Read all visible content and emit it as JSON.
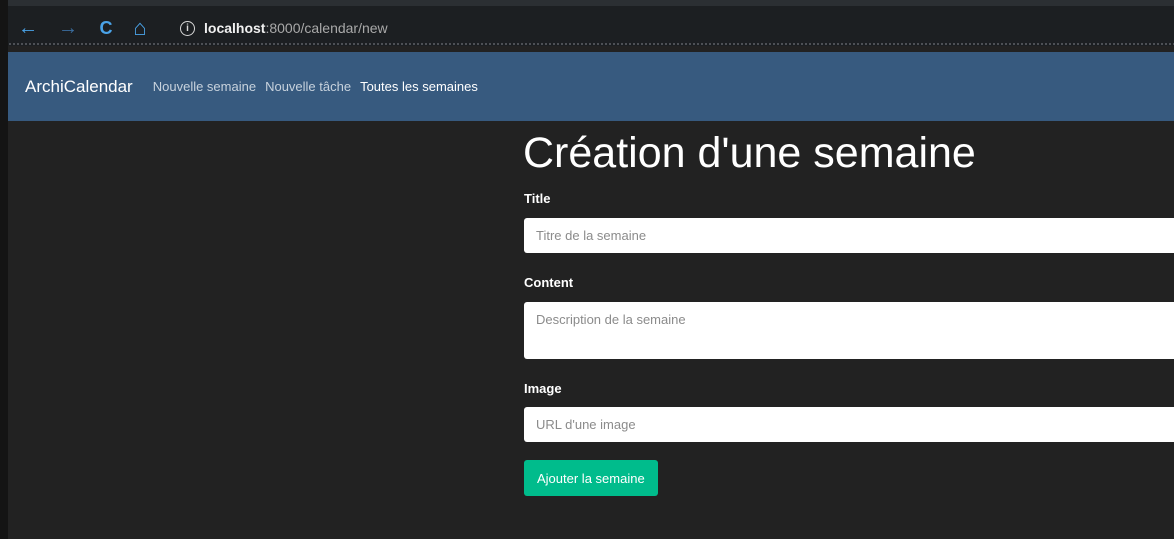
{
  "browser": {
    "back_icon": "←",
    "forward_icon": "→",
    "reload_icon": "C",
    "home_icon": "⌂",
    "info_icon": "i",
    "url_host": "localhost",
    "url_path": ":8000/calendar/new"
  },
  "navbar": {
    "brand": "ArchiCalendar",
    "links": [
      {
        "label": "Nouvelle semaine"
      },
      {
        "label": "Nouvelle tâche"
      },
      {
        "label": "Toutes les semaines"
      }
    ]
  },
  "form": {
    "title": "Création d'une semaine",
    "title_label": "Title",
    "title_placeholder": "Titre de la semaine",
    "content_label": "Content",
    "content_placeholder": "Description de la semaine",
    "image_label": "Image",
    "image_placeholder": "URL d'une image",
    "submit_label": "Ajouter la semaine"
  },
  "colors": {
    "background": "#222222",
    "navbar": "#375a7f",
    "accent": "#00bc8c"
  }
}
